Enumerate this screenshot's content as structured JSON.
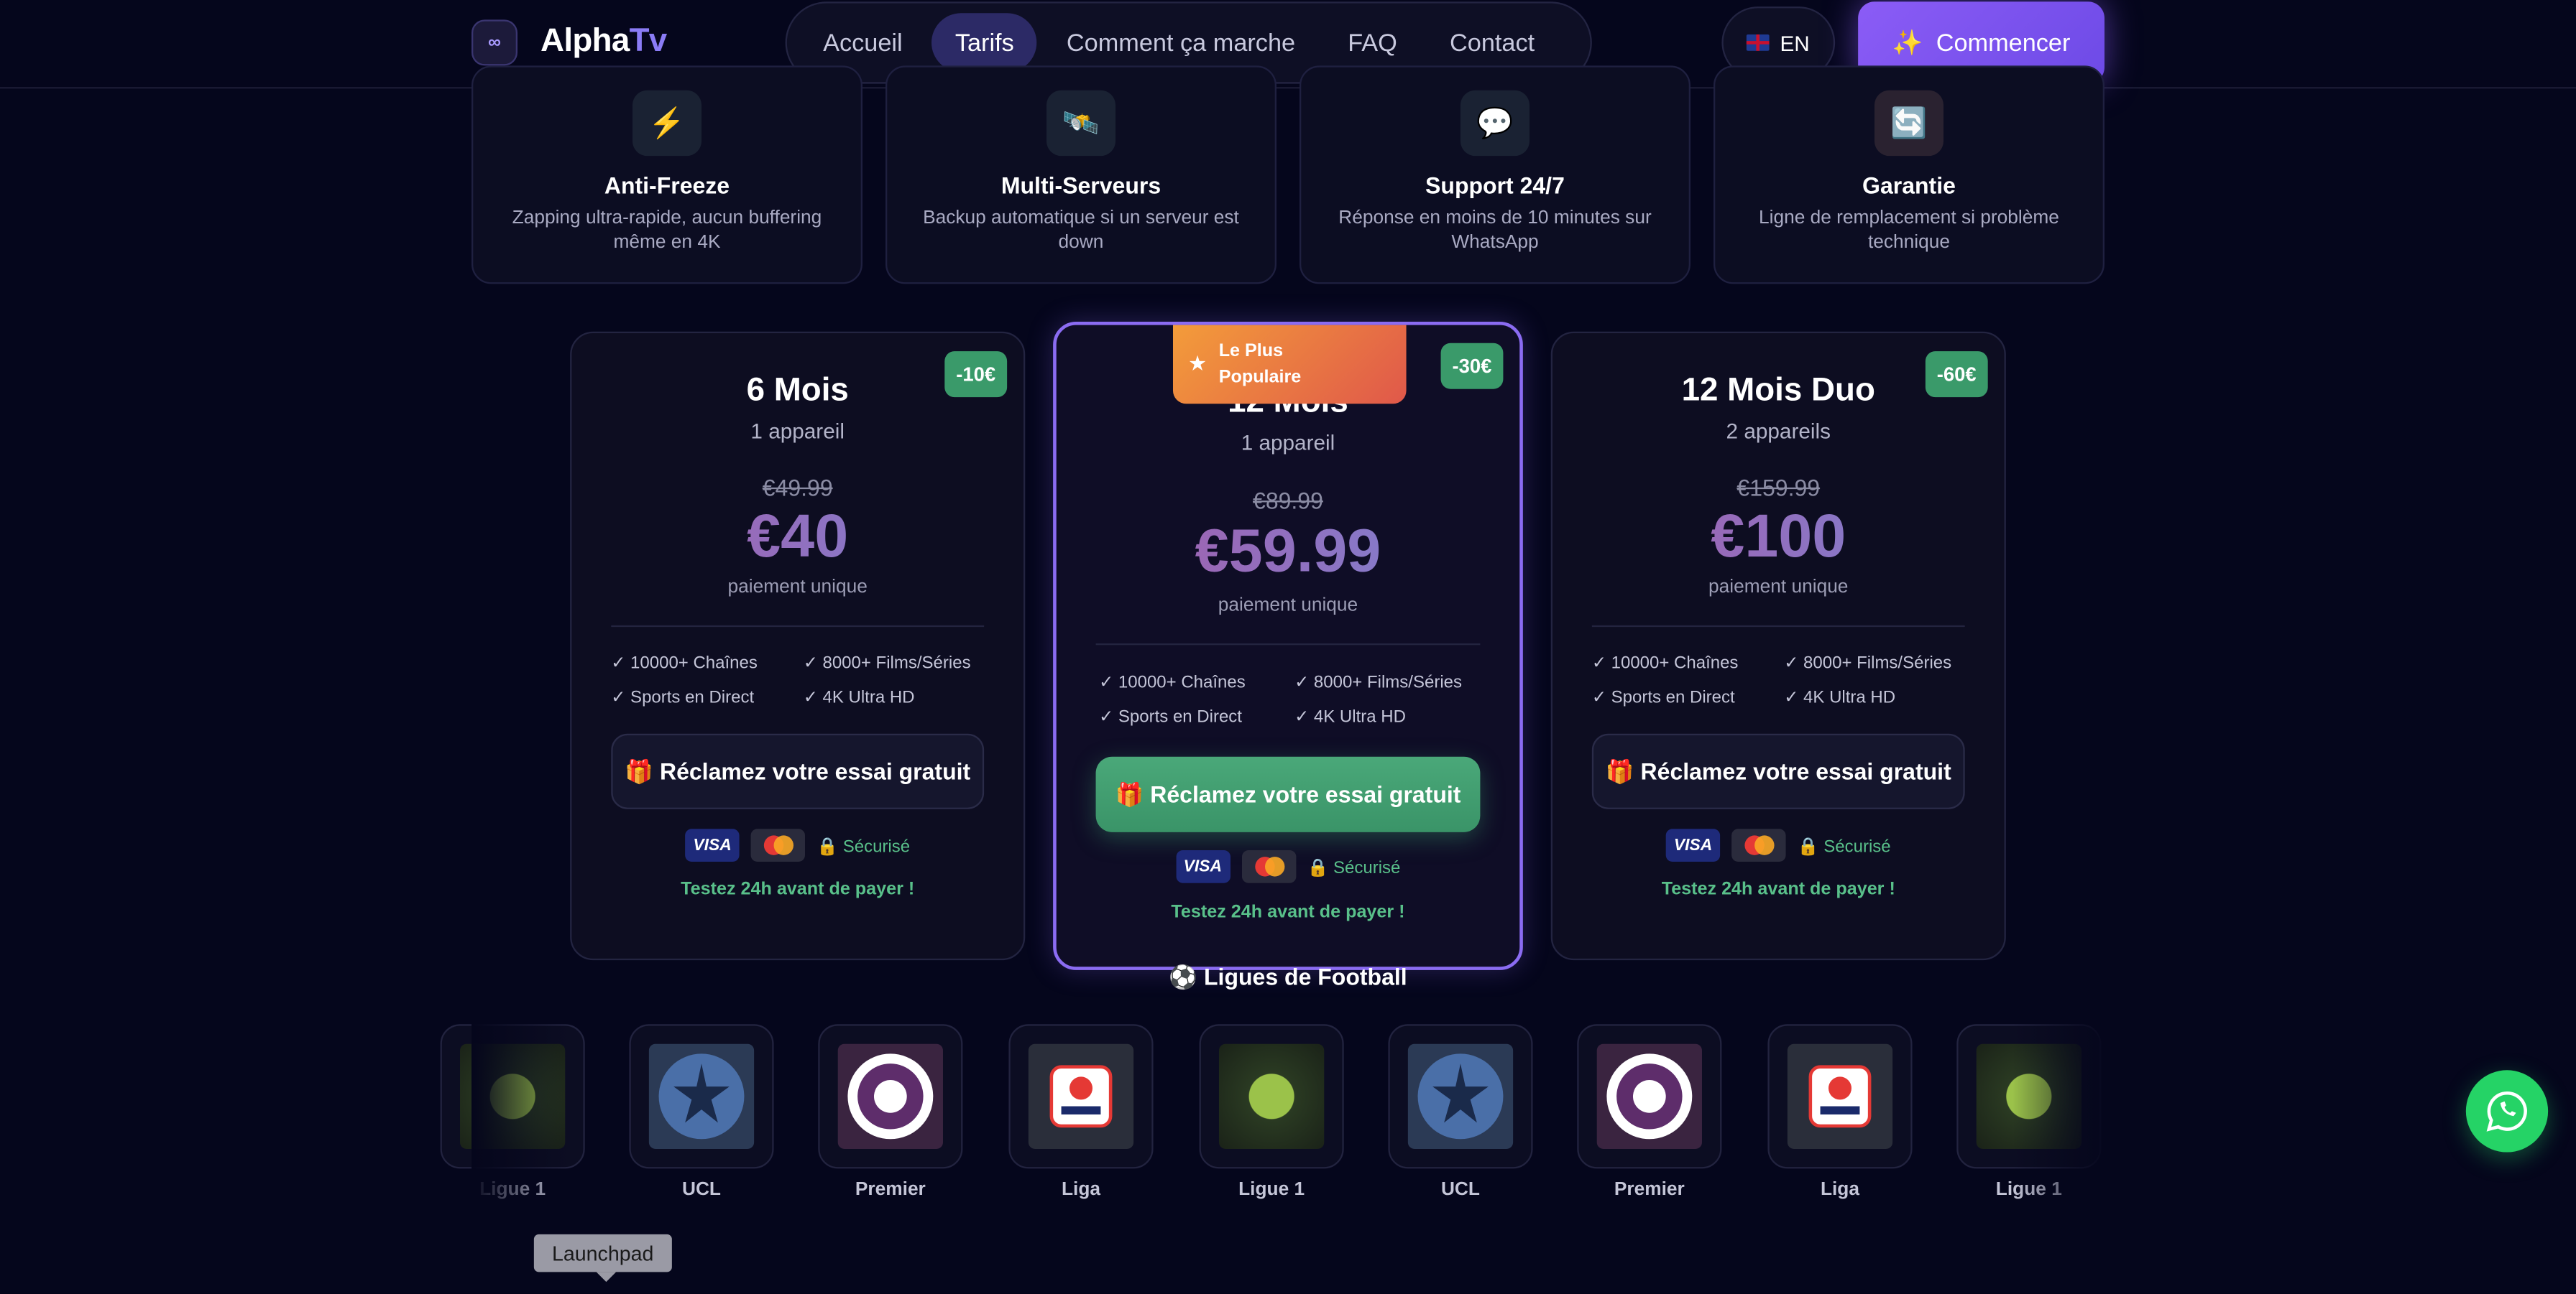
{
  "header": {
    "brand_alpha": "Alpha",
    "brand_tv": "Tv",
    "nav": [
      "Accueil",
      "Tarifs",
      "Comment ça marche",
      "FAQ",
      "Contact"
    ],
    "active_nav": "Tarifs",
    "lang": "EN",
    "start_label": "Commencer"
  },
  "features": [
    {
      "icon": "⚡",
      "title": "Anti-Freeze",
      "desc": "Zapping ultra-rapide, aucun buffering même en 4K"
    },
    {
      "icon": "🛰️",
      "title": "Multi-Serveurs",
      "desc": "Backup automatique si un serveur est down"
    },
    {
      "icon": "💬",
      "title": "Support 24/7",
      "desc": "Réponse en moins de 10 minutes sur WhatsApp"
    },
    {
      "icon": "🔄",
      "title": "Garantie",
      "desc": "Ligne de remplacement si problème technique"
    }
  ],
  "plans": [
    {
      "discount": "-10€",
      "name": "6 Mois",
      "devices": "1 appareil",
      "old_price": "€49.99",
      "price": "€40",
      "payment": "paiement unique",
      "features": [
        "✓ 10000+ Chaînes",
        "✓ 8000+ Films/Séries",
        "✓ Sports en Direct",
        "✓ 4K Ultra HD"
      ],
      "cta": "🎁 Réclamez votre essai gratuit",
      "secure": "🔒 Sécurisé",
      "trial": "Testez 24h avant de payer !"
    },
    {
      "discount": "-30€",
      "name": "12 Mois",
      "devices": "1 appareil",
      "old_price": "€89.99",
      "price": "€59.99",
      "payment": "paiement unique",
      "badge": "Le Plus Populaire",
      "features": [
        "✓ 10000+ Chaînes",
        "✓ 8000+ Films/Séries",
        "✓ Sports en Direct",
        "✓ 4K Ultra HD"
      ],
      "cta": "🎁 Réclamez votre essai gratuit",
      "secure": "🔒 Sécurisé",
      "trial": "Testez 24h avant de payer !"
    },
    {
      "discount": "-60€",
      "name": "12 Mois Duo",
      "devices": "2 appareils",
      "old_price": "€159.99",
      "price": "€100",
      "payment": "paiement unique",
      "features": [
        "✓ 10000+ Chaînes",
        "✓ 8000+ Films/Séries",
        "✓ Sports en Direct",
        "✓ 4K Ultra HD"
      ],
      "cta": "🎁 Réclamez votre essai gratuit",
      "secure": "🔒 Sécurisé",
      "trial": "Testez 24h avant de payer !"
    }
  ],
  "payment_visa": "VISA",
  "leagues_title": "⚽ Ligues de Football",
  "leagues": [
    "Ligue 1",
    "UCL",
    "Premier",
    "Liga",
    "Ligue 1",
    "UCL",
    "Premier",
    "Liga",
    "Ligue 1"
  ],
  "tooltip": "Launchpad",
  "colors": {
    "accent": "#8b5cf6",
    "green": "#3a9a6a",
    "whatsapp": "#25d366",
    "popular": "#e0584a"
  }
}
